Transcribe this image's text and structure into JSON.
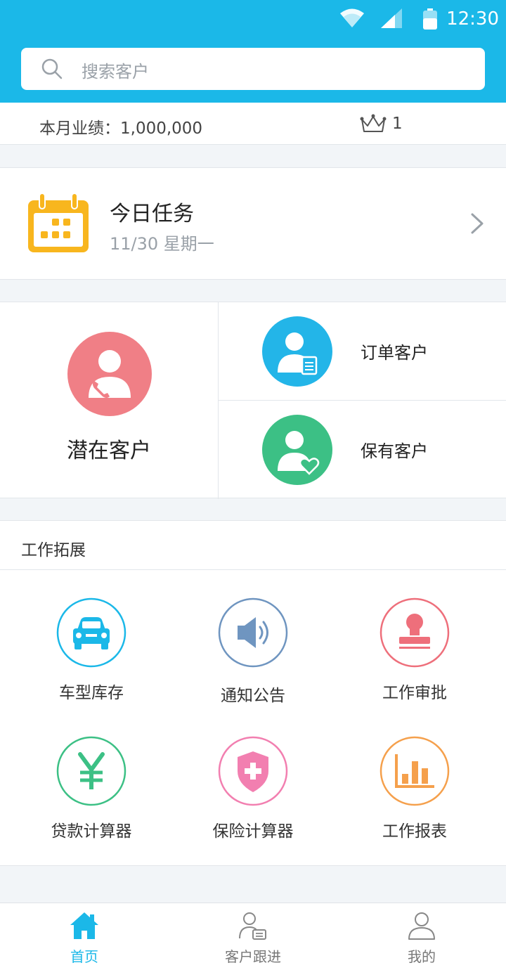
{
  "status_bar": {
    "time": "12:30"
  },
  "search": {
    "placeholder": "搜索客户"
  },
  "performance": {
    "label": "本月业绩：1,000,000",
    "rank": "1"
  },
  "today_task": {
    "title": "今日任务",
    "date": "11/30 星期一"
  },
  "customers": {
    "potential": "潜在客户",
    "order": "订单客户",
    "retained": "保有客户"
  },
  "work": {
    "header": "工作拓展",
    "items": [
      {
        "label": "车型库存",
        "icon": "car-icon",
        "color": "#1bb8e8"
      },
      {
        "label": "通知公告",
        "icon": "speaker-icon",
        "color": "#6f95c0"
      },
      {
        "label": "工作审批",
        "icon": "stamp-icon",
        "color": "#ee6f7b"
      },
      {
        "label": "贷款计算器",
        "icon": "yen-icon",
        "color": "#3cc085"
      },
      {
        "label": "保险计算器",
        "icon": "shield-icon",
        "color": "#f27fb0"
      },
      {
        "label": "工作报表",
        "icon": "bar-chart-icon",
        "color": "#f5a04c"
      }
    ]
  },
  "tabs": [
    {
      "label": "首页",
      "icon": "home-icon",
      "active": true
    },
    {
      "label": "客户跟进",
      "icon": "contact-card-icon",
      "active": false
    },
    {
      "label": "我的",
      "icon": "user-icon",
      "active": false
    }
  ]
}
